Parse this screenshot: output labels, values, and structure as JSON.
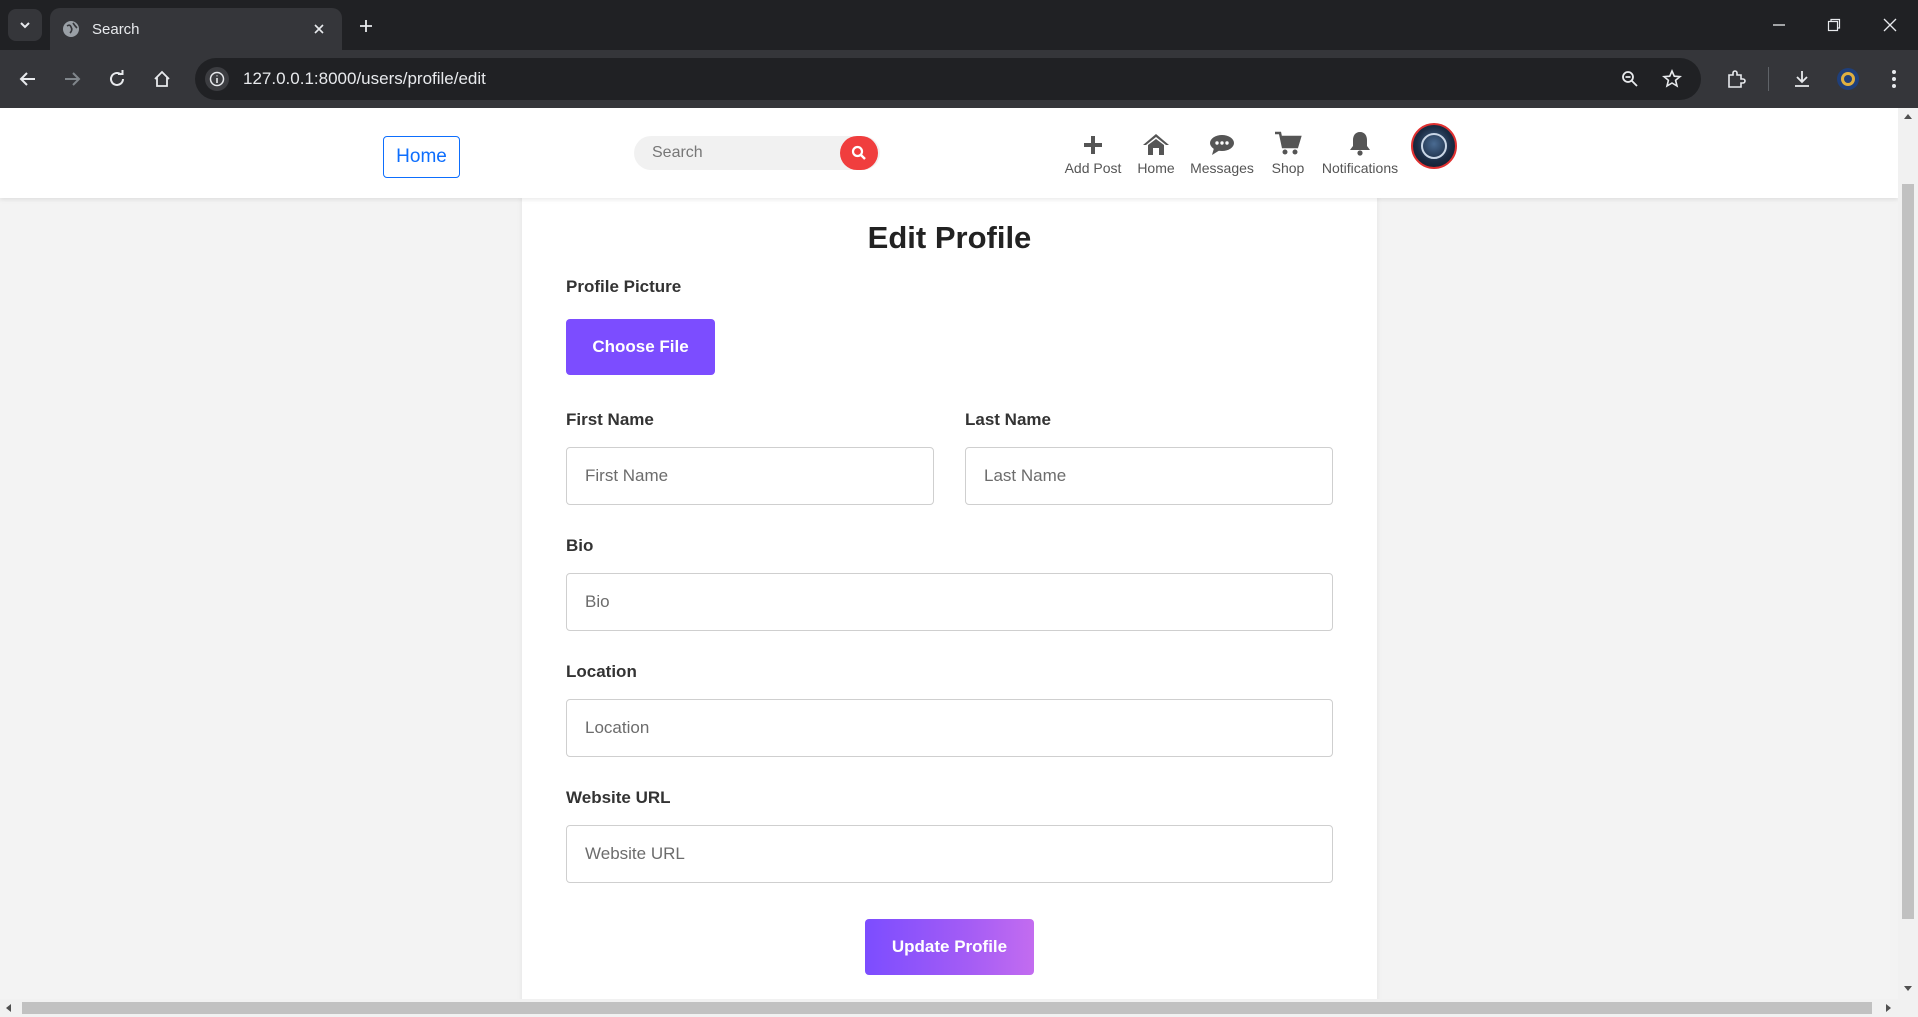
{
  "browser": {
    "tab_title": "Search",
    "url": "127.0.0.1:8000/users/profile/edit"
  },
  "header": {
    "home_button": "Home",
    "search_placeholder": "Search",
    "nav": [
      {
        "label": "Add Post",
        "icon": "plus-icon"
      },
      {
        "label": "Home",
        "icon": "home-icon"
      },
      {
        "label": "Messages",
        "icon": "chat-bubbles-icon"
      },
      {
        "label": "Shop",
        "icon": "cart-icon"
      },
      {
        "label": "Notifications",
        "icon": "bell-icon"
      }
    ],
    "avatar_icon": "user-avatar"
  },
  "form": {
    "title": "Edit Profile",
    "profile_picture_label": "Profile Picture",
    "choose_file_button": "Choose File",
    "first_name_label": "First Name",
    "first_name_placeholder": "First Name",
    "last_name_label": "Last Name",
    "last_name_placeholder": "Last Name",
    "bio_label": "Bio",
    "bio_placeholder": "Bio",
    "location_label": "Location",
    "location_placeholder": "Location",
    "website_label": "Website URL",
    "website_placeholder": "Website URL",
    "submit_button": "Update Profile"
  },
  "colors": {
    "accent_purple": "#7c4dff",
    "search_red": "#f03e3e",
    "link_blue": "#0d6efd",
    "chrome_dark": "#202124"
  }
}
